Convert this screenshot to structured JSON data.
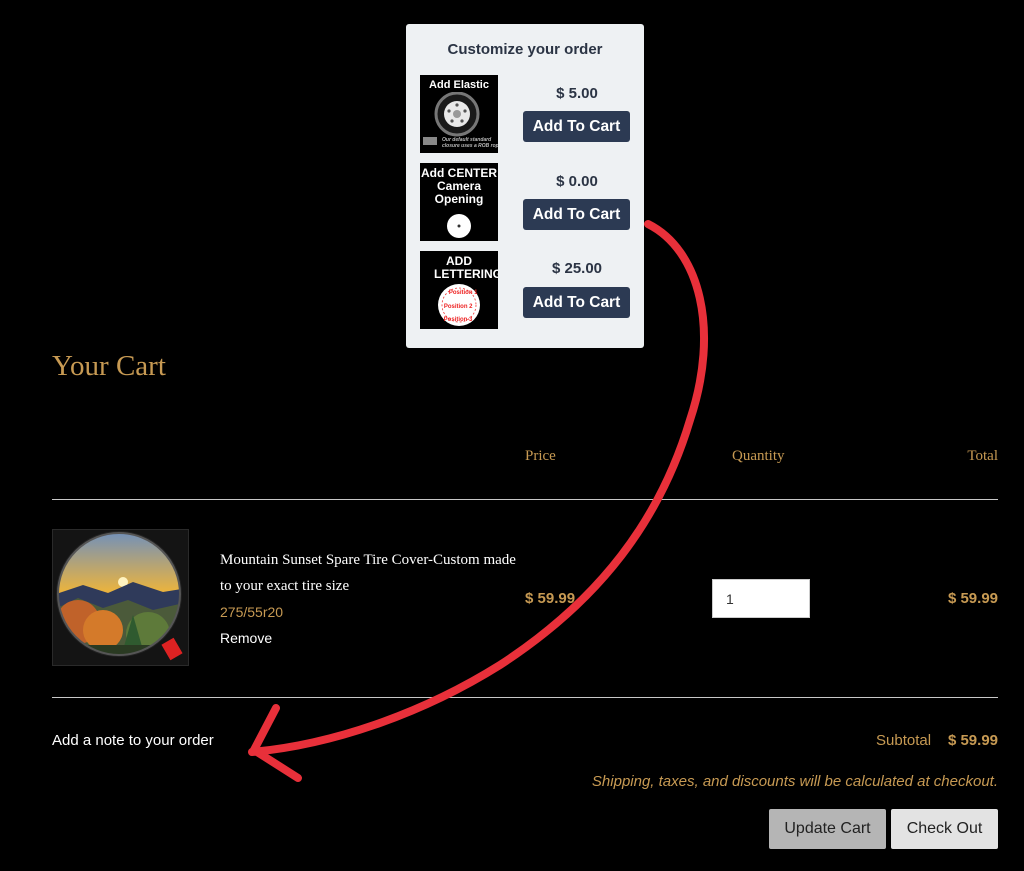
{
  "popup": {
    "title": "Customize your order",
    "options": [
      {
        "caption": "Add Elastic",
        "price": "$ 5.00",
        "button": "Add To Cart",
        "icon": "tire-icon",
        "fine_print": "Our default standard closure uses a ROB rope"
      },
      {
        "caption": "Add CENTER Camera Opening",
        "price": "$ 0.00",
        "button": "Add To Cart",
        "icon": "camera-opening-icon"
      },
      {
        "caption": "ADD LETTERING",
        "price": "$ 25.00",
        "button": "Add To Cart",
        "icon": "lettering-positions-icon",
        "positions": [
          "Position 1",
          "Position 2",
          "Position 3"
        ]
      }
    ]
  },
  "cart": {
    "title": "Your Cart",
    "columns": {
      "price": "Price",
      "quantity": "Quantity",
      "total": "Total"
    },
    "item": {
      "title": "Mountain Sunset Spare Tire Cover-Custom made to your exact tire size",
      "variant": "275/55r20",
      "remove": "Remove",
      "price": "$ 59.99",
      "quantity": "1",
      "total": "$ 59.99"
    },
    "note_link": "Add a note to your order",
    "subtotal_label": "Subtotal",
    "subtotal_value": "$ 59.99",
    "shipping_note": "Shipping, taxes, and discounts will be calculated at checkout.",
    "update_button": "Update Cart",
    "checkout_button": "Check Out"
  },
  "colors": {
    "accent": "#c79a53",
    "button_dark": "#2c3a53",
    "annotation_arrow": "#e8303a",
    "popup_bg": "#eef1f3"
  }
}
